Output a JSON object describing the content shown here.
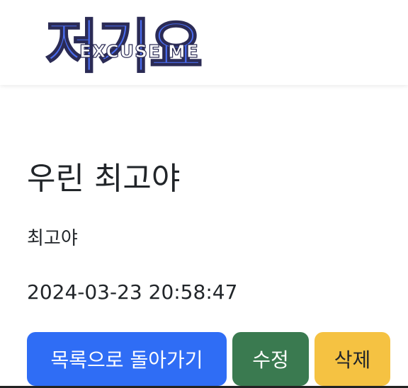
{
  "header": {
    "logo_main": "저기요",
    "logo_sub": "EXCUSE ME"
  },
  "post": {
    "title": "우린 최고야",
    "content": "최고야",
    "date": "2024-03-23 20:58:47"
  },
  "actions": {
    "back_label": "목록으로 돌아가기",
    "edit_label": "수정",
    "delete_label": "삭제"
  },
  "colors": {
    "brand_blue": "#4a6df0",
    "back_button": "#2f6df5",
    "edit_button": "#3a7a50",
    "delete_button": "#f5c242"
  }
}
